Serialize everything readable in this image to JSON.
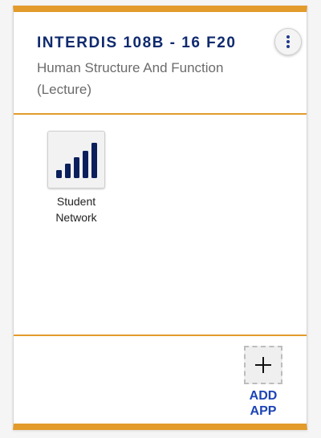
{
  "course": {
    "code": "INTERDIS 108B - 16 F20",
    "name": "Human Structure And Function (Lecture)"
  },
  "menu": {
    "icon": "more-vertical-icon"
  },
  "apps": [
    {
      "label": "Student Network",
      "icon": "signal-bars-icon"
    }
  ],
  "add_app": {
    "label_line1": "ADD",
    "label_line2": "APP",
    "icon": "plus-icon"
  },
  "colors": {
    "accent": "#e39b2b",
    "title": "#0f2a6e",
    "link": "#1c44b5",
    "icon_bars": "#0b1f5c"
  }
}
